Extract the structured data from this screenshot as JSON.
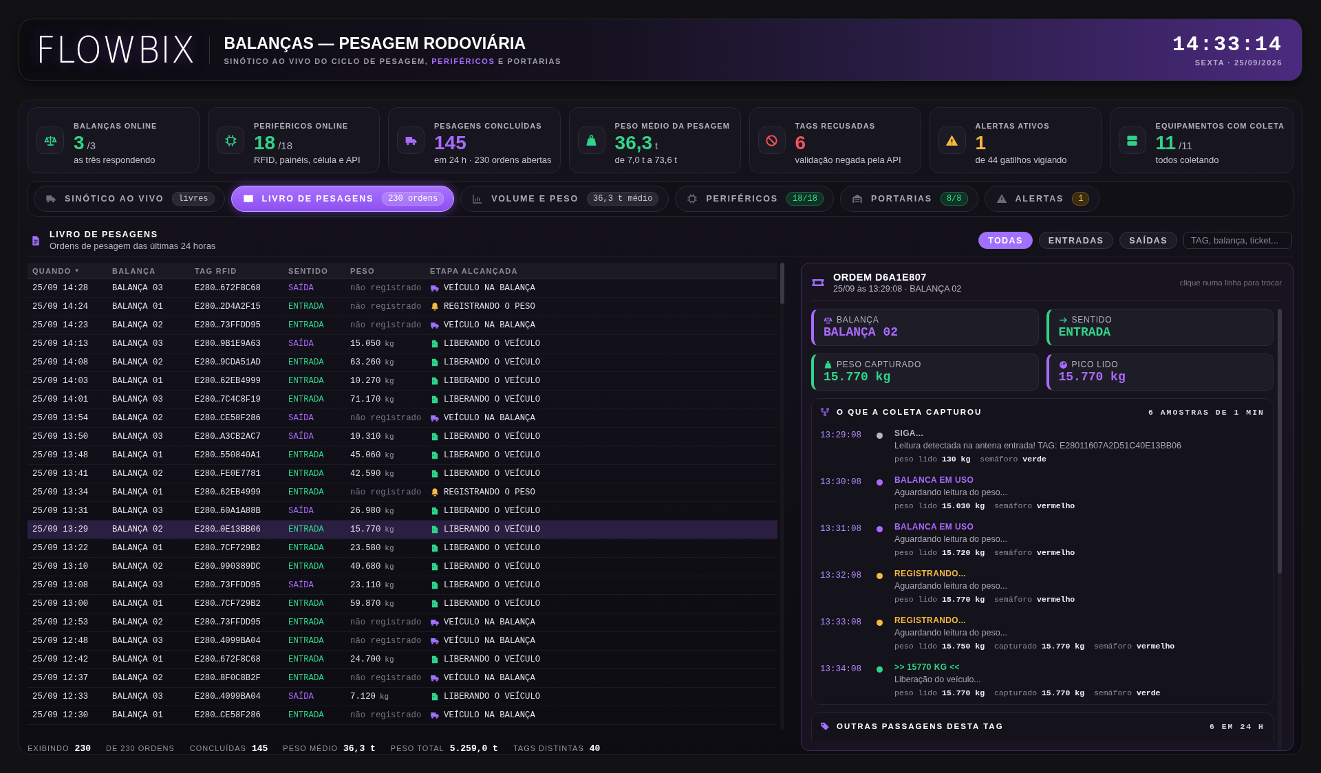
{
  "header": {
    "logo": "FLOWBIX",
    "title": "BALANÇAS — PESAGEM RODOVIÁRIA",
    "subtitle": [
      {
        "text": "SINÓTICO AO VIVO DO CICLO DE PESAGEM, ",
        "accent": false
      },
      {
        "text": "PERIFÉRICOS",
        "accent": true
      },
      {
        "text": " E PORTARIAS",
        "accent": false
      }
    ],
    "time": "14:33:14",
    "date": "SEXTA · 25/09/2026"
  },
  "kpis": [
    {
      "label": "BALANÇAS ONLINE",
      "value": "3",
      "total": "/3",
      "note": "as três respondendo",
      "color": "#2fd48a"
    },
    {
      "label": "PERIFÉRICOS ONLINE",
      "value": "18",
      "total": "/18",
      "note": "RFID, painéis, célula e API",
      "color": "#2fd48a"
    },
    {
      "label": "PESAGENS CONCLUÍDAS",
      "value": "145",
      "note": "em 24 h · 230 ordens abertas",
      "color": "#a86bff"
    },
    {
      "label": "PESO MÉDIO DA PESAGEM",
      "value": "36,3",
      "total": "t",
      "note": "de 7,0 t a 73,6 t",
      "color": "#2fd48a"
    },
    {
      "label": "TAGS RECUSADAS",
      "value": "6",
      "note": "validação negada pela API",
      "color": "#f0525f"
    },
    {
      "label": "ALERTAS ATIVOS",
      "value": "1",
      "note": "de 44 gatilhos vigiando",
      "color": "#f5b942"
    },
    {
      "label": "EQUIPAMENTOS COM COLETA",
      "value": "11",
      "total": "/11",
      "note": "todos coletando",
      "color": "#2fd48a"
    }
  ],
  "tabs": [
    {
      "label": "SINÓTICO AO VIVO",
      "badge": {
        "label": "livres",
        "kind": "neutral"
      },
      "selected": false
    },
    {
      "label": "LIVRO DE PESAGENS",
      "badge": {
        "label": "230 ordens",
        "kind": "accent"
      },
      "selected": true
    },
    {
      "label": "VOLUME E PESO",
      "badge": {
        "label": "36,3 t médio",
        "kind": "neutral"
      },
      "selected": false
    },
    {
      "label": "PERIFÉRICOS",
      "badge": {
        "label": "18/18",
        "kind": "ok"
      },
      "selected": false
    },
    {
      "label": "PORTARIAS",
      "badge": {
        "label": "8/8",
        "kind": "ok"
      },
      "selected": false
    },
    {
      "label": "ALERTAS",
      "badge": {
        "label": "1",
        "kind": "warn"
      },
      "selected": false
    }
  ],
  "section": {
    "title": "LIVRO DE PESAGENS",
    "subtitle": "Ordens de pesagem das últimas 24 horas"
  },
  "filters": [
    {
      "label": "TODAS",
      "selected": true
    },
    {
      "label": "ENTRADAS",
      "selected": false
    },
    {
      "label": "SAÍDAS",
      "selected": false
    }
  ],
  "search": {
    "placeholder": "TAG, balança, ticket..."
  },
  "table": {
    "columns": [
      {
        "label": "QUANDO",
        "caret": "▼"
      },
      {
        "label": "BALANÇA"
      },
      {
        "label": "TAG RFID"
      },
      {
        "label": "SENTIDO"
      },
      {
        "label": "PESO"
      },
      {
        "label": "ETAPA ALCANÇADA"
      }
    ],
    "rows": [
      {
        "when": "25/09 14:28",
        "scale": "BALANÇA 03",
        "tag": "E280…672F8C68",
        "direction": {
          "label": "SAÍDA",
          "kind": "out"
        },
        "weight": {
          "value": "não registrado"
        },
        "stage": {
          "label": "VEÍCULO NA BALANÇA",
          "kind": "truck"
        },
        "selected": false
      },
      {
        "when": "25/09 14:24",
        "scale": "BALANÇA 01",
        "tag": "E280…2D4A2F15",
        "direction": {
          "label": "ENTRADA",
          "kind": "in"
        },
        "weight": {
          "value": "não registrado"
        },
        "stage": {
          "label": "REGISTRANDO O PESO",
          "kind": "bell"
        },
        "selected": false
      },
      {
        "when": "25/09 14:23",
        "scale": "BALANÇA 02",
        "tag": "E280…73FFDD95",
        "direction": {
          "label": "ENTRADA",
          "kind": "in"
        },
        "weight": {
          "value": "não registrado"
        },
        "stage": {
          "label": "VEÍCULO NA BALANÇA",
          "kind": "truck"
        },
        "selected": false
      },
      {
        "when": "25/09 14:13",
        "scale": "BALANÇA 03",
        "tag": "E280…9B1E9A63",
        "direction": {
          "label": "SAÍDA",
          "kind": "out"
        },
        "weight": {
          "value": "15.050",
          "unit": "kg"
        },
        "stage": {
          "label": "LIBERANDO O VEÍCULO",
          "kind": "door"
        },
        "selected": false
      },
      {
        "when": "25/09 14:08",
        "scale": "BALANÇA 02",
        "tag": "E280…9CDA51AD",
        "direction": {
          "label": "ENTRADA",
          "kind": "in"
        },
        "weight": {
          "value": "63.260",
          "unit": "kg"
        },
        "stage": {
          "label": "LIBERANDO O VEÍCULO",
          "kind": "door"
        },
        "selected": false
      },
      {
        "when": "25/09 14:03",
        "scale": "BALANÇA 01",
        "tag": "E280…62EB4999",
        "direction": {
          "label": "ENTRADA",
          "kind": "in"
        },
        "weight": {
          "value": "10.270",
          "unit": "kg"
        },
        "stage": {
          "label": "LIBERANDO O VEÍCULO",
          "kind": "door"
        },
        "selected": false
      },
      {
        "when": "25/09 14:01",
        "scale": "BALANÇA 03",
        "tag": "E280…7C4C8F19",
        "direction": {
          "label": "ENTRADA",
          "kind": "in"
        },
        "weight": {
          "value": "71.170",
          "unit": "kg"
        },
        "stage": {
          "label": "LIBERANDO O VEÍCULO",
          "kind": "door"
        },
        "selected": false
      },
      {
        "when": "25/09 13:54",
        "scale": "BALANÇA 02",
        "tag": "E280…CE58F286",
        "direction": {
          "label": "SAÍDA",
          "kind": "out"
        },
        "weight": {
          "value": "não registrado"
        },
        "stage": {
          "label": "VEÍCULO NA BALANÇA",
          "kind": "truck"
        },
        "selected": false
      },
      {
        "when": "25/09 13:50",
        "scale": "BALANÇA 03",
        "tag": "E280…A3CB2AC7",
        "direction": {
          "label": "SAÍDA",
          "kind": "out"
        },
        "weight": {
          "value": "10.310",
          "unit": "kg"
        },
        "stage": {
          "label": "LIBERANDO O VEÍCULO",
          "kind": "door"
        },
        "selected": false
      },
      {
        "when": "25/09 13:48",
        "scale": "BALANÇA 01",
        "tag": "E280…550840A1",
        "direction": {
          "label": "ENTRADA",
          "kind": "in"
        },
        "weight": {
          "value": "45.060",
          "unit": "kg"
        },
        "stage": {
          "label": "LIBERANDO O VEÍCULO",
          "kind": "door"
        },
        "selected": false
      },
      {
        "when": "25/09 13:41",
        "scale": "BALANÇA 02",
        "tag": "E280…FE0E7781",
        "direction": {
          "label": "ENTRADA",
          "kind": "in"
        },
        "weight": {
          "value": "42.590",
          "unit": "kg"
        },
        "stage": {
          "label": "LIBERANDO O VEÍCULO",
          "kind": "door"
        },
        "selected": false
      },
      {
        "when": "25/09 13:34",
        "scale": "BALANÇA 01",
        "tag": "E280…62EB4999",
        "direction": {
          "label": "ENTRADA",
          "kind": "in"
        },
        "weight": {
          "value": "não registrado"
        },
        "stage": {
          "label": "REGISTRANDO O PESO",
          "kind": "bell"
        },
        "selected": false
      },
      {
        "when": "25/09 13:31",
        "scale": "BALANÇA 03",
        "tag": "E280…60A1A88B",
        "direction": {
          "label": "SAÍDA",
          "kind": "out"
        },
        "weight": {
          "value": "26.980",
          "unit": "kg"
        },
        "stage": {
          "label": "LIBERANDO O VEÍCULO",
          "kind": "door"
        },
        "selected": false
      },
      {
        "when": "25/09 13:29",
        "scale": "BALANÇA 02",
        "tag": "E280…0E13BB06",
        "direction": {
          "label": "ENTRADA",
          "kind": "in"
        },
        "weight": {
          "value": "15.770",
          "unit": "kg"
        },
        "stage": {
          "label": "LIBERANDO O VEÍCULO",
          "kind": "door"
        },
        "selected": true
      },
      {
        "when": "25/09 13:22",
        "scale": "BALANÇA 01",
        "tag": "E280…7CF729B2",
        "direction": {
          "label": "ENTRADA",
          "kind": "in"
        },
        "weight": {
          "value": "23.580",
          "unit": "kg"
        },
        "stage": {
          "label": "LIBERANDO O VEÍCULO",
          "kind": "door"
        },
        "selected": false
      },
      {
        "when": "25/09 13:10",
        "scale": "BALANÇA 02",
        "tag": "E280…990389DC",
        "direction": {
          "label": "ENTRADA",
          "kind": "in"
        },
        "weight": {
          "value": "40.680",
          "unit": "kg"
        },
        "stage": {
          "label": "LIBERANDO O VEÍCULO",
          "kind": "door"
        },
        "selected": false
      },
      {
        "when": "25/09 13:08",
        "scale": "BALANÇA 03",
        "tag": "E280…73FFDD95",
        "direction": {
          "label": "SAÍDA",
          "kind": "out"
        },
        "weight": {
          "value": "23.110",
          "unit": "kg"
        },
        "stage": {
          "label": "LIBERANDO O VEÍCULO",
          "kind": "door"
        },
        "selected": false
      },
      {
        "when": "25/09 13:00",
        "scale": "BALANÇA 01",
        "tag": "E280…7CF729B2",
        "direction": {
          "label": "ENTRADA",
          "kind": "in"
        },
        "weight": {
          "value": "59.870",
          "unit": "kg"
        },
        "stage": {
          "label": "LIBERANDO O VEÍCULO",
          "kind": "door"
        },
        "selected": false
      },
      {
        "when": "25/09 12:53",
        "scale": "BALANÇA 02",
        "tag": "E280…73FFDD95",
        "direction": {
          "label": "ENTRADA",
          "kind": "in"
        },
        "weight": {
          "value": "não registrado"
        },
        "stage": {
          "label": "VEÍCULO NA BALANÇA",
          "kind": "truck"
        },
        "selected": false
      },
      {
        "when": "25/09 12:48",
        "scale": "BALANÇA 03",
        "tag": "E280…4099BA04",
        "direction": {
          "label": "ENTRADA",
          "kind": "in"
        },
        "weight": {
          "value": "não registrado"
        },
        "stage": {
          "label": "VEÍCULO NA BALANÇA",
          "kind": "truck"
        },
        "selected": false
      },
      {
        "when": "25/09 12:42",
        "scale": "BALANÇA 01",
        "tag": "E280…672F8C68",
        "direction": {
          "label": "ENTRADA",
          "kind": "in"
        },
        "weight": {
          "value": "24.700",
          "unit": "kg"
        },
        "stage": {
          "label": "LIBERANDO O VEÍCULO",
          "kind": "door"
        },
        "selected": false
      },
      {
        "when": "25/09 12:37",
        "scale": "BALANÇA 02",
        "tag": "E280…8F0C8B2F",
        "direction": {
          "label": "ENTRADA",
          "kind": "in"
        },
        "weight": {
          "value": "não registrado"
        },
        "stage": {
          "label": "VEÍCULO NA BALANÇA",
          "kind": "truck"
        },
        "selected": false
      },
      {
        "when": "25/09 12:33",
        "scale": "BALANÇA 03",
        "tag": "E280…4099BA04",
        "direction": {
          "label": "SAÍDA",
          "kind": "out"
        },
        "weight": {
          "value": "7.120",
          "unit": "kg"
        },
        "stage": {
          "label": "LIBERANDO O VEÍCULO",
          "kind": "door"
        },
        "selected": false
      },
      {
        "when": "25/09 12:30",
        "scale": "BALANÇA 01",
        "tag": "E280…CE58F286",
        "direction": {
          "label": "ENTRADA",
          "kind": "in"
        },
        "weight": {
          "value": "não registrado"
        },
        "stage": {
          "label": "VEÍCULO NA BALANÇA",
          "kind": "truck"
        },
        "selected": false
      }
    ]
  },
  "footer": [
    {
      "label": "EXIBINDO",
      "value": "230",
      "suffix": "DE 230 ORDENS"
    },
    {
      "label": "CONCLUÍDAS",
      "value": "145"
    },
    {
      "label": "PESO MÉDIO",
      "value": "36,3 t"
    },
    {
      "label": "PESO TOTAL",
      "value": "5.259,0 t"
    },
    {
      "label": "TAGS DISTINTAS",
      "value": "40"
    }
  ],
  "detail": {
    "title": "ORDEM D6A1E807",
    "subtitle": "25/09 às 13:29:08 · BALANÇA 02",
    "hint": "clique numa linha para trocar",
    "fields": [
      {
        "label": "BALANÇA",
        "value": "BALANÇA 02",
        "color": "#a86bff"
      },
      {
        "label": "SENTIDO",
        "value": "ENTRADA",
        "color": "#2fd48a"
      },
      {
        "label": "PESO CAPTURADO",
        "value": "15.770 kg",
        "color": "#2fd48a"
      },
      {
        "label": "PICO LIDO",
        "value": "15.770 kg",
        "color": "#a86bff"
      }
    ],
    "capture": {
      "title": "O QUE A COLETA CAPTUROU",
      "count": "6 AMOSTRAS DE 1 MIN",
      "samples": [
        {
          "time": "13:29:08",
          "color": "#b8b5c2",
          "status": "SIGA...",
          "message": "Leitura detectada na antena entrada! TAG: E28011607A2D51C40E13BB06",
          "readings": "peso lido **130 kg**  semáforo **verde**"
        },
        {
          "time": "13:30:08",
          "color": "#a86bff",
          "status": "BALANCA EM USO",
          "message": "Aguardando leitura do peso...",
          "readings": "peso lido **15.030 kg**  semáforo **vermelho**"
        },
        {
          "time": "13:31:08",
          "color": "#a86bff",
          "status": "BALANCA EM USO",
          "message": "Aguardando leitura do peso...",
          "readings": "peso lido **15.720 kg**  semáforo **vermelho**"
        },
        {
          "time": "13:32:08",
          "color": "#f5b942",
          "status": "REGISTRANDO...",
          "message": "Aguardando leitura do peso...",
          "readings": "peso lido **15.770 kg**  semáforo **vermelho**"
        },
        {
          "time": "13:33:08",
          "color": "#f5b942",
          "status": "REGISTRANDO...",
          "message": "Aguardando leitura do peso...",
          "readings": "peso lido **15.750 kg**  capturado **15.770 kg**  semáforo **vermelho**"
        },
        {
          "time": "13:34:08",
          "color": "#2fd48a",
          "status": ">> 15770 KG <<",
          "message": "Liberação do veículo...",
          "readings": "peso lido **15.770 kg**  capturado **15.770 kg**  semáforo **verde**"
        }
      ]
    },
    "others": {
      "title": "OUTRAS PASSAGENS DESTA TAG",
      "count": "6 EM 24 H"
    }
  }
}
